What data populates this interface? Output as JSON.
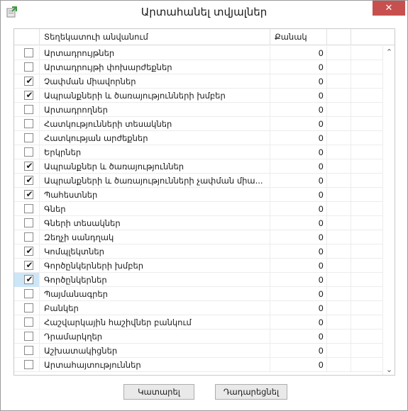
{
  "window": {
    "title": "Արտահանել տվյալներ",
    "close_label": "✕"
  },
  "grid": {
    "columns": [
      "",
      "Տեղեկատուի անվանում",
      "Քանակ",
      "",
      ""
    ],
    "rows": [
      {
        "checked": false,
        "name": "Արտադրույթներ",
        "qty": "0",
        "selected": false
      },
      {
        "checked": false,
        "name": "Արտադրույթի փոխարժեքներ",
        "qty": "0",
        "selected": false
      },
      {
        "checked": true,
        "name": "Չափման միավորներ",
        "qty": "0",
        "selected": false
      },
      {
        "checked": true,
        "name": "Ապրանքների և ծառայությունների խմբեր",
        "qty": "0",
        "selected": false
      },
      {
        "checked": false,
        "name": "Արտադրողներ",
        "qty": "0",
        "selected": false
      },
      {
        "checked": false,
        "name": "Հատկությունների տեսակներ",
        "qty": "0",
        "selected": false
      },
      {
        "checked": false,
        "name": "Հատկության արժեքներ",
        "qty": "0",
        "selected": false
      },
      {
        "checked": false,
        "name": "Երկրներ",
        "qty": "0",
        "selected": false
      },
      {
        "checked": true,
        "name": "Ապրանքներ և ծառայություններ",
        "qty": "0",
        "selected": false
      },
      {
        "checked": true,
        "name": "Ապրանքների և ծառայությունների չափման միա...",
        "qty": "0",
        "selected": false
      },
      {
        "checked": true,
        "name": "Պահեստներ",
        "qty": "0",
        "selected": false
      },
      {
        "checked": false,
        "name": "Գներ",
        "qty": "0",
        "selected": false
      },
      {
        "checked": false,
        "name": "Գների տեսակներ",
        "qty": "0",
        "selected": false
      },
      {
        "checked": false,
        "name": "Զեղչի սանդղակ",
        "qty": "0",
        "selected": false
      },
      {
        "checked": true,
        "name": "Կոմպլեկտներ",
        "qty": "0",
        "selected": false
      },
      {
        "checked": true,
        "name": "Գործընկերների խմբեր",
        "qty": "0",
        "selected": false
      },
      {
        "checked": true,
        "name": "Գործընկերներ",
        "qty": "0",
        "selected": true
      },
      {
        "checked": false,
        "name": "Պայմանագրեր",
        "qty": "0",
        "selected": false
      },
      {
        "checked": false,
        "name": "Բանկեր",
        "qty": "0",
        "selected": false
      },
      {
        "checked": false,
        "name": "Հաշվարկային հաշիվներ բանկում",
        "qty": "0",
        "selected": false
      },
      {
        "checked": false,
        "name": "Դրամարկղեր",
        "qty": "0",
        "selected": false
      },
      {
        "checked": false,
        "name": "Աշխատակիցներ",
        "qty": "0",
        "selected": false
      },
      {
        "checked": false,
        "name": "Արտահայտություններ",
        "qty": "0",
        "selected": false
      }
    ]
  },
  "buttons": {
    "ok": "Կատարել",
    "cancel": "Դադարեցնել"
  },
  "icons": {
    "app": "export-icon",
    "check": "checkmark-icon",
    "scroll_up": "chevron-up-icon",
    "scroll_down": "chevron-down-icon"
  },
  "colors": {
    "close": "#c7504f",
    "selection": "#cde6f7"
  }
}
